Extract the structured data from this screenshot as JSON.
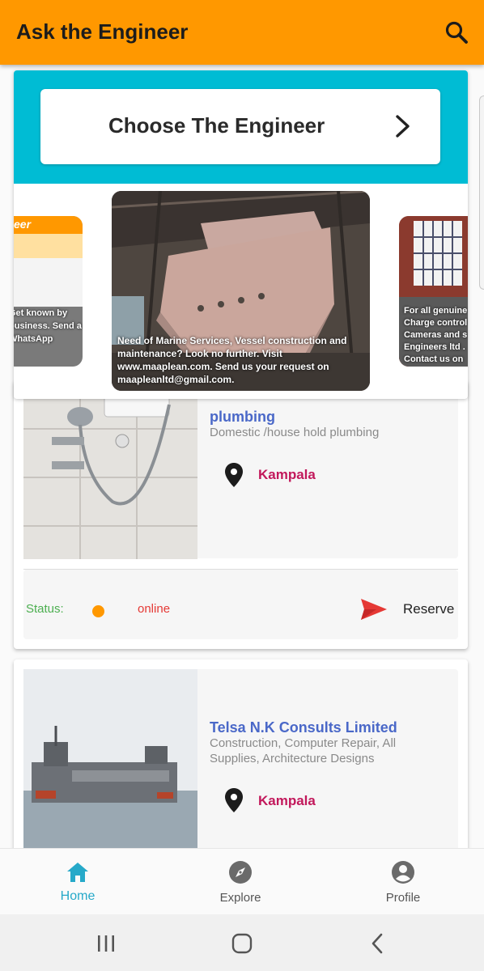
{
  "app_bar": {
    "title": "Ask the Engineer",
    "search_icon": "search-icon",
    "color": "#ff9800"
  },
  "hero": {
    "choose_label": "Choose The Engineer",
    "band_color": "#00bcd4"
  },
  "carousel": {
    "slides": [
      {
        "position": "left",
        "caption_top": "eer",
        "caption": "Get known by\nbusiness. Send a\nWhatsApp"
      },
      {
        "position": "center",
        "caption": "Need of Marine Services, Vessel construction and maintenance? Look no further. Visit www.maaplean.com. Send  us your request on maapleanltd@gmail.com."
      },
      {
        "position": "right",
        "caption": "For all genuine\nCharge control\nCameras and s\nEngineers ltd .\nContact us on"
      }
    ]
  },
  "listings": [
    {
      "name": "plumbing",
      "description": "Domestic /house hold plumbing",
      "location": "Kampala",
      "status_label": "Status:",
      "status_value": "online",
      "action_label": "Reserve"
    },
    {
      "name": "Telsa N.K Consults Limited",
      "description": "Construction, Computer Repair, All Supplies, Architecture Designs",
      "location": "Kampala"
    }
  ],
  "bottom_nav": {
    "items": [
      {
        "label": "Home",
        "icon": "home-icon",
        "active": true
      },
      {
        "label": "Explore",
        "icon": "compass-icon",
        "active": false
      },
      {
        "label": "Profile",
        "icon": "account-circle-icon",
        "active": false
      }
    ],
    "active_color": "#26a9c9"
  }
}
